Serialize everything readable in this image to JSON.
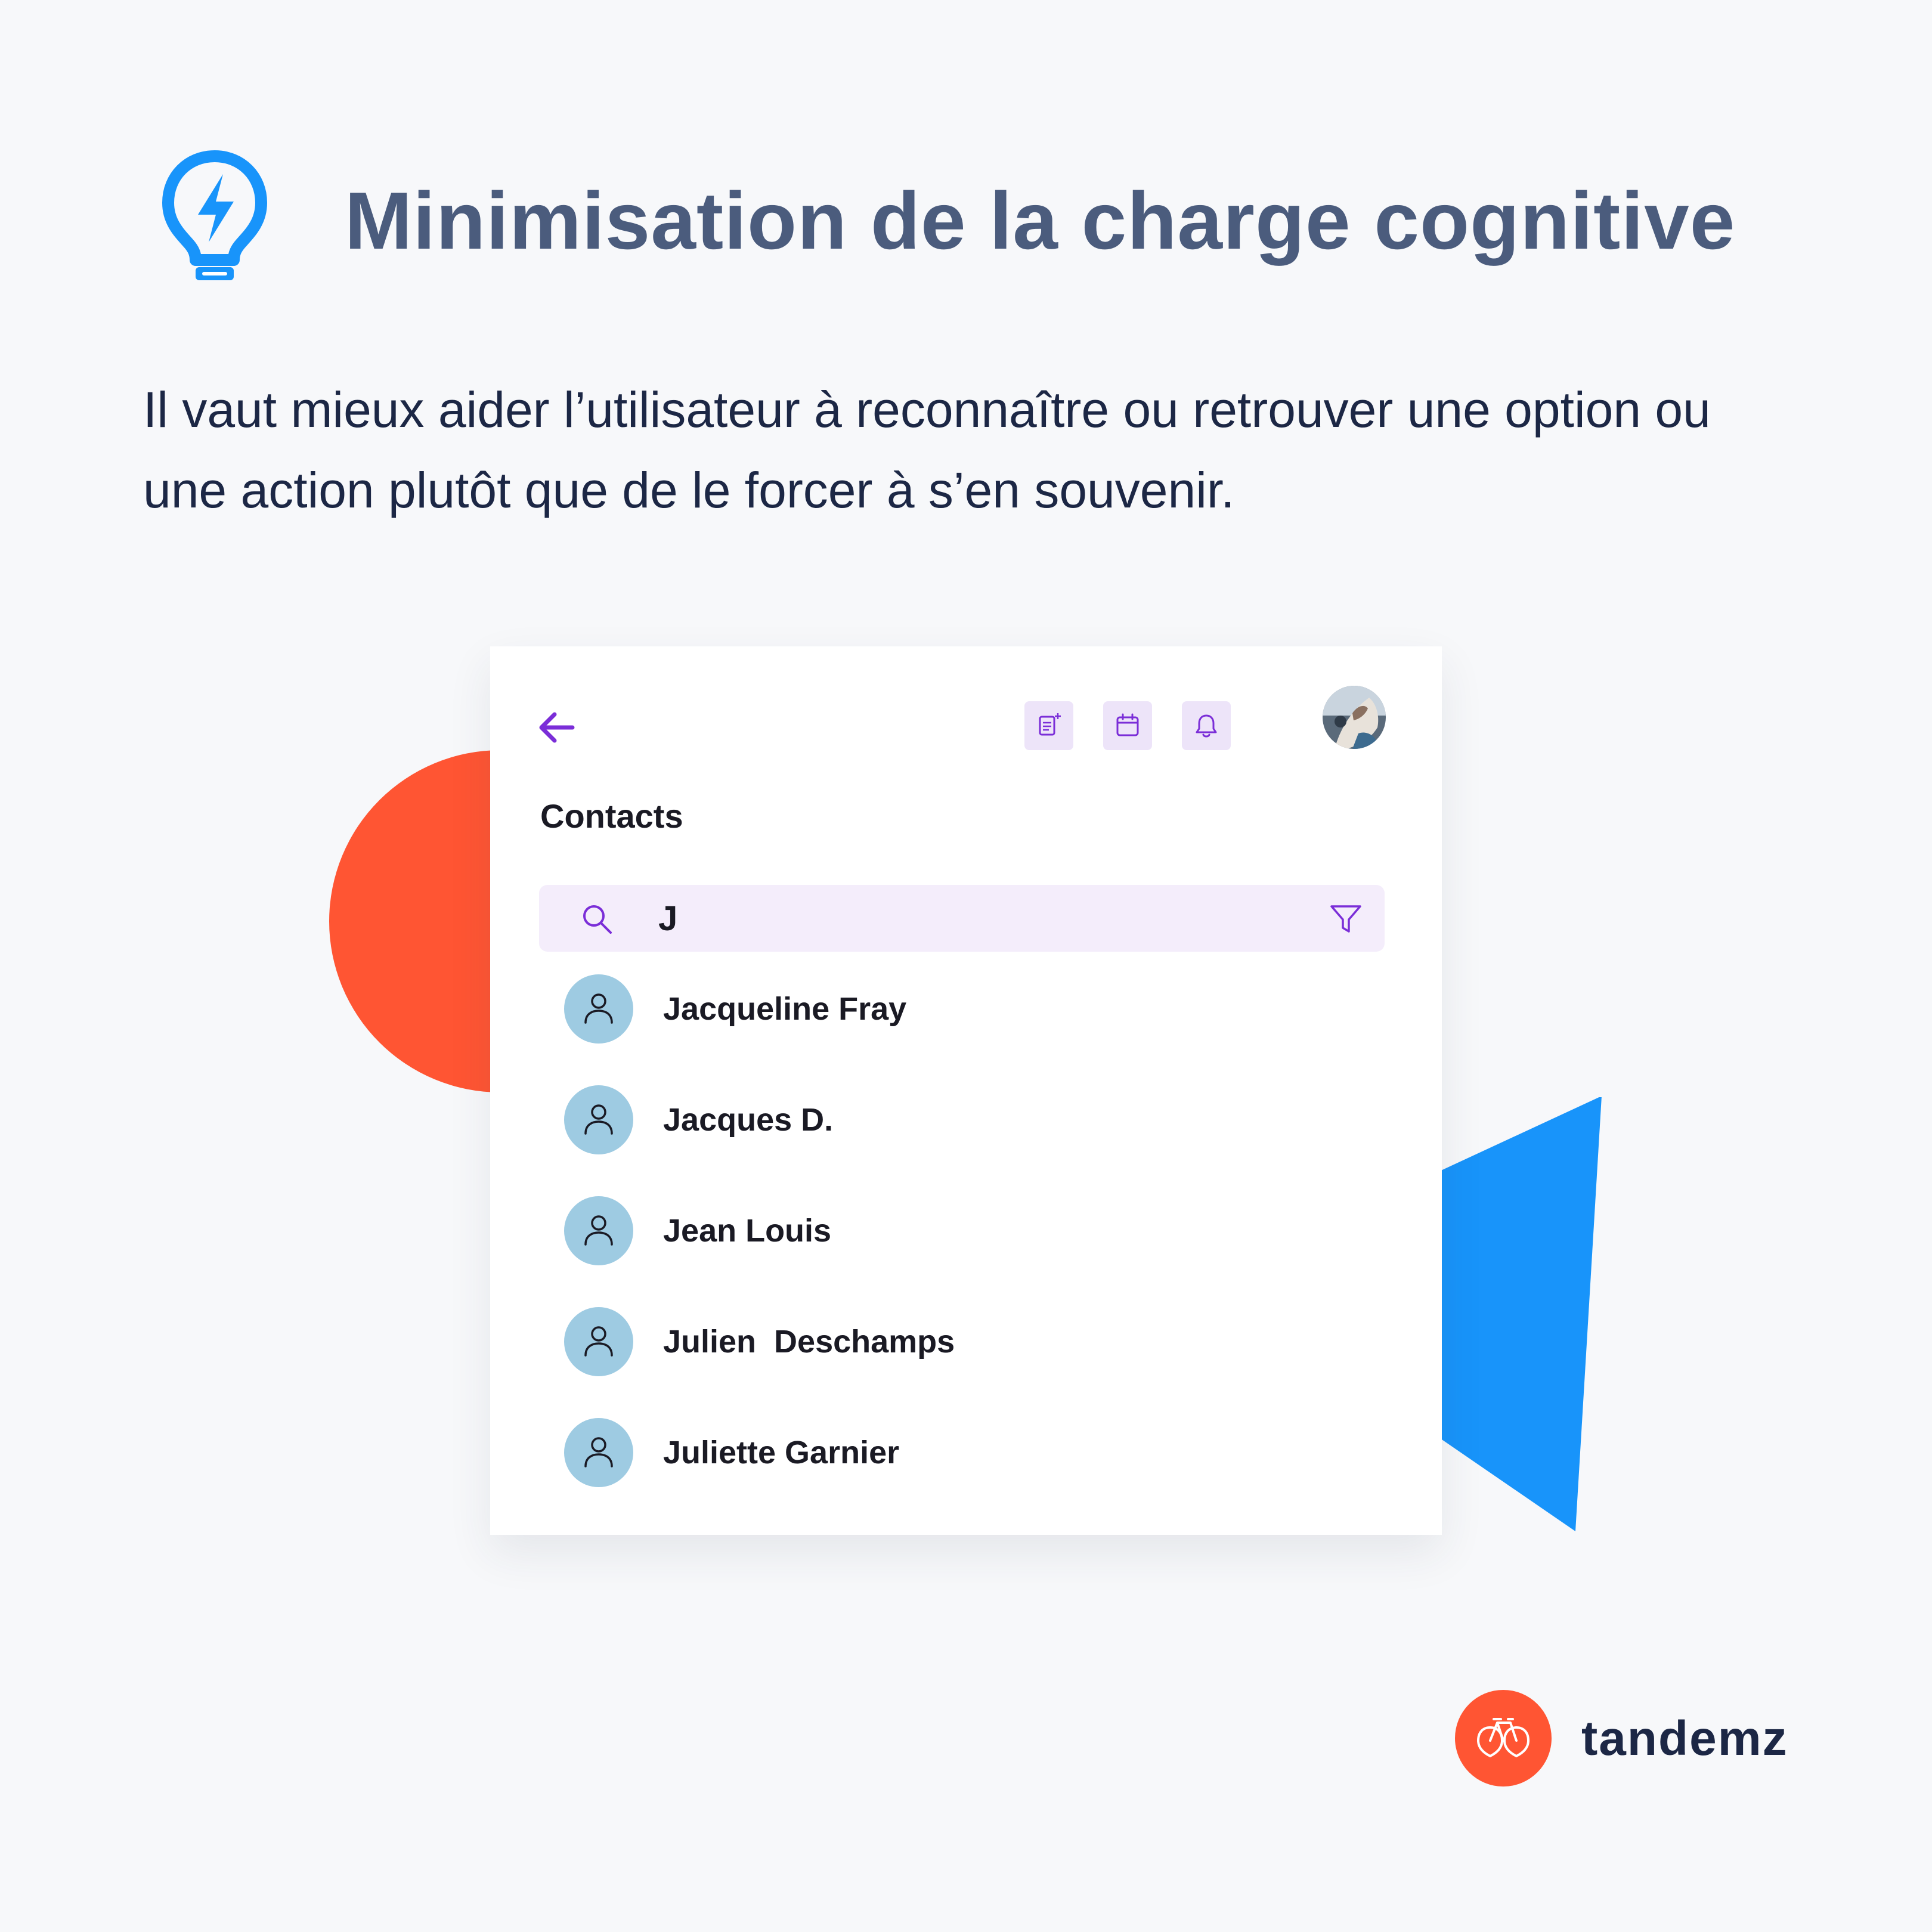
{
  "title": "Minimisation de la charge cognitive",
  "subtitle": "Il vaut mieux aider l’utilisateur à reconnaître ou retrouver une option ou une action plutôt que de le forcer à s’en souvenir.",
  "colors": {
    "title": "#4b5c7d",
    "accent_blue": "#1894fa",
    "accent_orange": "#ff5533",
    "accent_purple": "#7b2ed8",
    "search_bg": "#f4edfb",
    "contact_avatar_bg": "#9ecbe2"
  },
  "app": {
    "header_icons": [
      "new-note-icon",
      "calendar-icon",
      "bell-icon"
    ],
    "section_title": "Contacts",
    "search": {
      "value": "J",
      "placeholder": ""
    },
    "contacts": [
      {
        "name": "Jacqueline Fray"
      },
      {
        "name": "Jacques D."
      },
      {
        "name": "Jean Louis"
      },
      {
        "name": "Julien  Deschamps"
      },
      {
        "name": "Juliette Garnier"
      }
    ]
  },
  "brand": {
    "name": "tandemz"
  }
}
